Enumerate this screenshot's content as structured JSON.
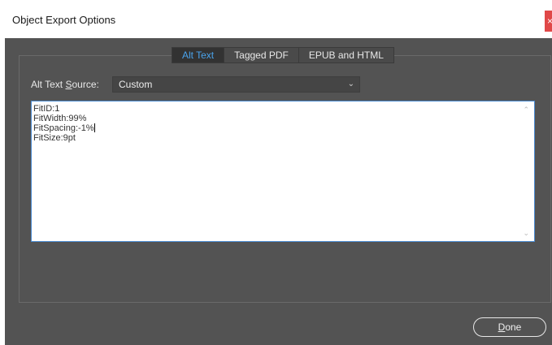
{
  "window": {
    "title": "Object Export Options",
    "close_glyph": "×"
  },
  "tabs": [
    {
      "label": "Alt Text",
      "active": true
    },
    {
      "label": "Tagged PDF",
      "active": false
    },
    {
      "label": "EPUB and HTML",
      "active": false
    }
  ],
  "alt_text_source": {
    "label_pre": "Alt Text ",
    "label_mnemonic": "S",
    "label_post": "ource:",
    "selected_value": "Custom",
    "dropdown_icon": "chevron-down-icon"
  },
  "text_content": {
    "lines": [
      "FitID:1",
      "FitWidth:99%",
      "FitSpacing:-1%",
      "FitSize:9pt"
    ]
  },
  "done_button": {
    "mnemonic": "D",
    "rest": "one"
  },
  "colors": {
    "dialog_bg": "#535353",
    "active_tab_text": "#4aa3ec",
    "text_focus_border": "#4a8ad0",
    "close_red": "#e04848"
  }
}
